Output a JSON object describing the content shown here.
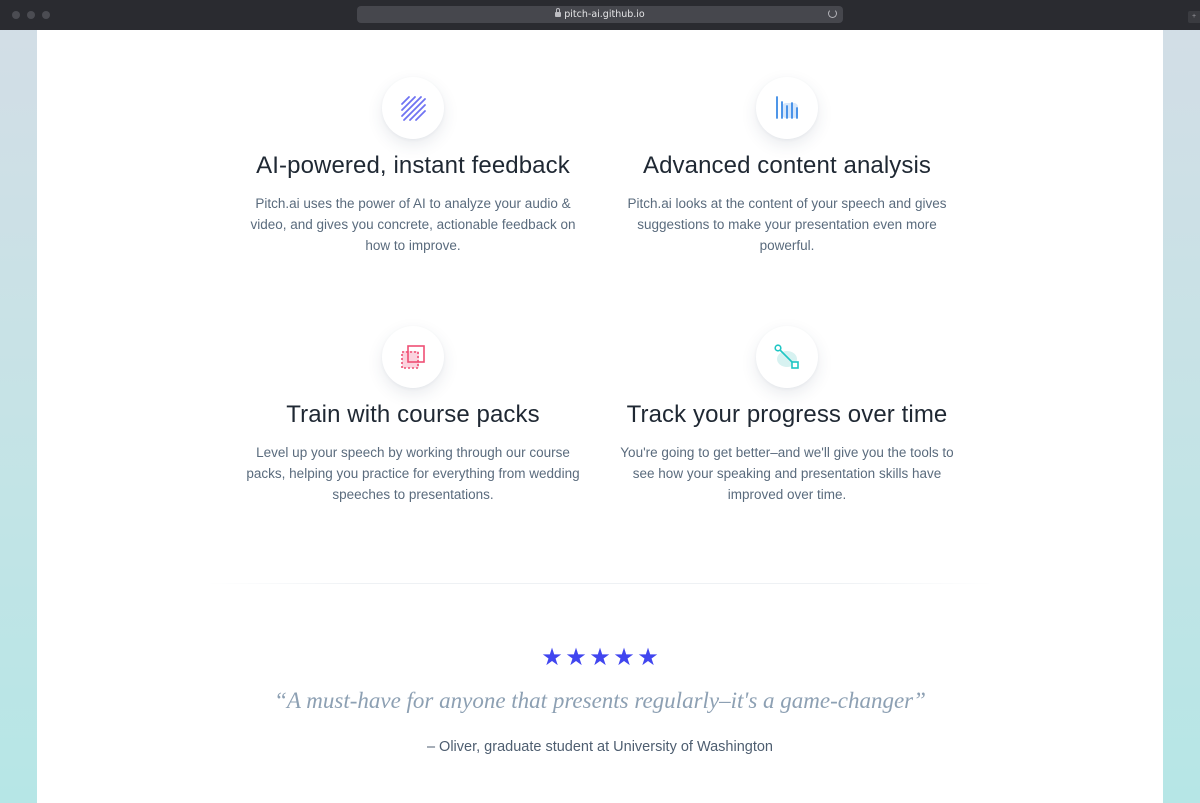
{
  "browser": {
    "url": "pitch-ai.github.io"
  },
  "features": [
    {
      "icon": "diagonal-stripes-icon",
      "title": "AI-powered, instant feedback",
      "description": "Pitch.ai uses the power of AI to analyze your audio & video, and gives you concrete, actionable feedback on how to improve."
    },
    {
      "icon": "bar-chart-icon",
      "title": "Advanced content analysis",
      "description": "Pitch.ai looks at the content of your speech and gives suggestions to make your presentation even more powerful."
    },
    {
      "icon": "stacked-squares-icon",
      "title": "Train with course packs",
      "description": "Level up your speech by working through our course packs, helping you practice for everything from wedding speeches to presentations."
    },
    {
      "icon": "connected-nodes-icon",
      "title": "Track your progress over time",
      "description": "You're going to get better–and we'll give you the tools to see how your speaking and presentation skills have improved over time."
    }
  ],
  "testimonial": {
    "rating": 5,
    "rating_max": 5,
    "star_color": "#4146ef",
    "quote": "“A must-have for anyone that presents regularly–it's a game-changer”",
    "attribution": "– Oliver, graduate student at University of Washington"
  }
}
